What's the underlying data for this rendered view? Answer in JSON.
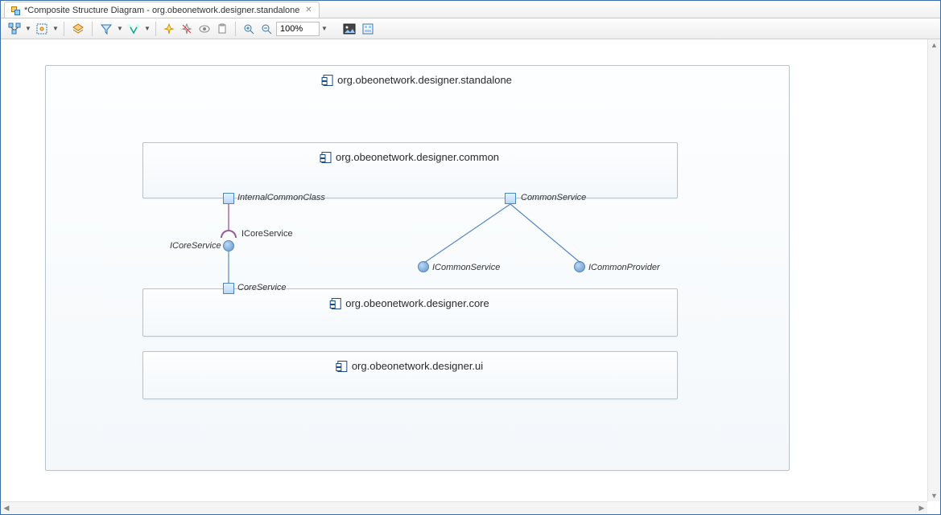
{
  "tab": {
    "title": "*Composite Structure Diagram - org.obeonetwork.designer.standalone",
    "icon": "diagram-icon"
  },
  "toolbar": {
    "zoom_value": "100%"
  },
  "diagram": {
    "outer_package": "org.obeonetwork.designer.standalone",
    "components": {
      "common": {
        "name": "org.obeonetwork.designer.common",
        "ports": {
          "internal_common_class": "InternalCommonClass",
          "common_service": "CommonService"
        }
      },
      "core": {
        "name": "org.obeonetwork.designer.core",
        "ports": {
          "core_service": "CoreService"
        }
      },
      "ui": {
        "name": "org.obeonetwork.designer.ui"
      }
    },
    "interfaces": {
      "icoreservice_required": "ICoreService",
      "icoreservice_provided": "ICoreService",
      "icommonservice": "ICommonService",
      "icommonprovider": "ICommonProvider"
    }
  }
}
